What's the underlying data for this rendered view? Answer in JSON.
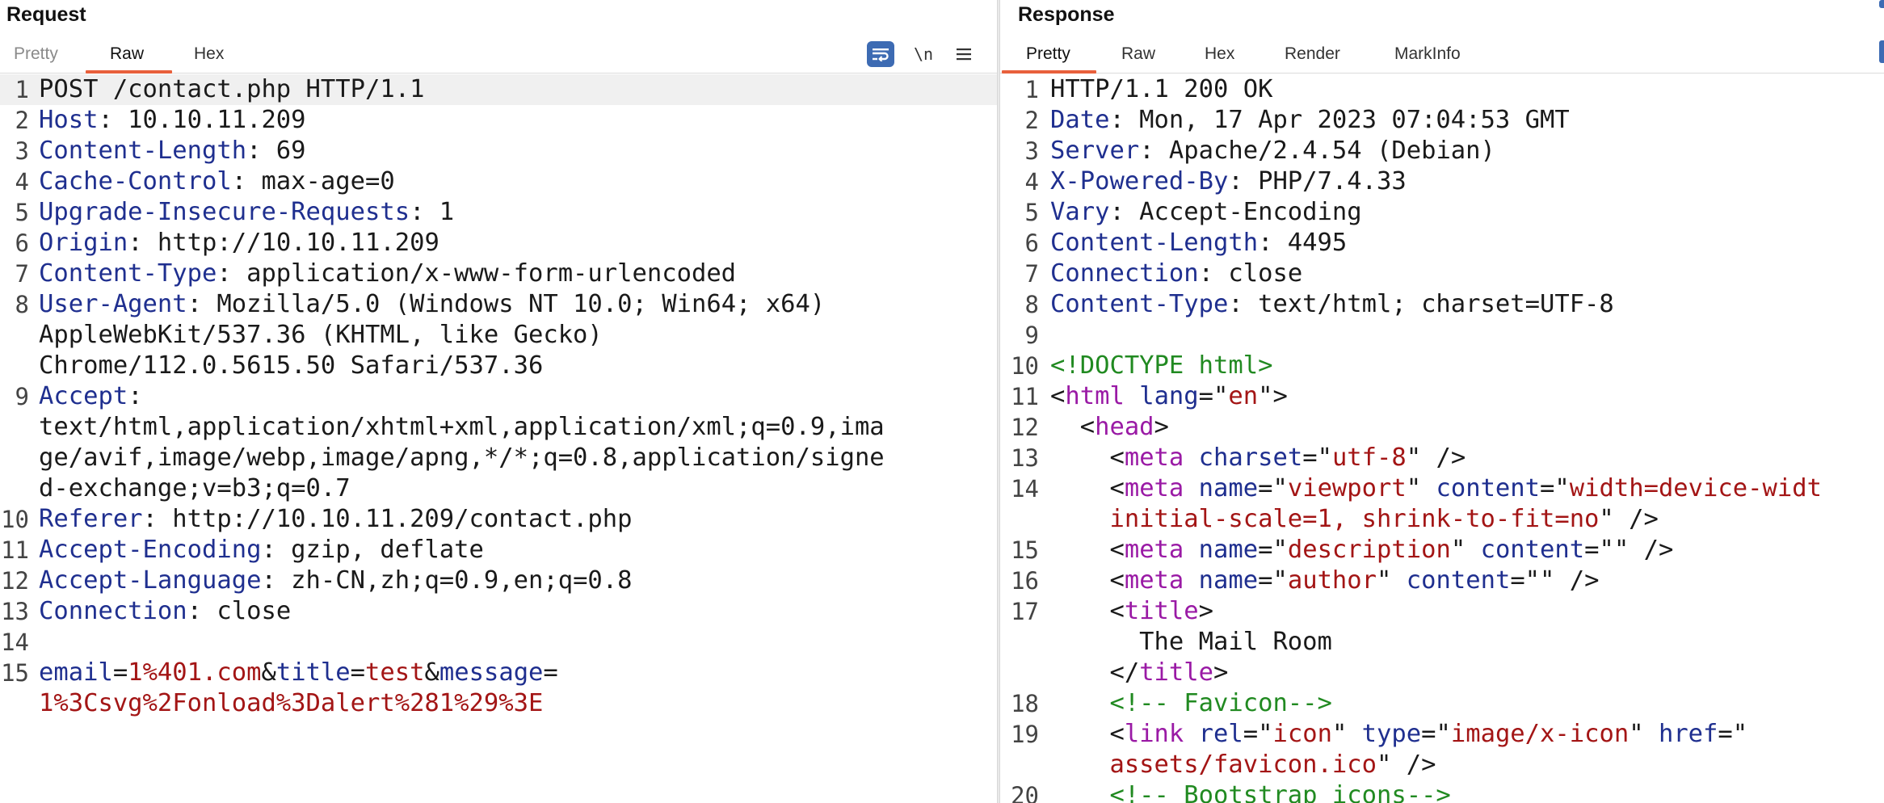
{
  "request": {
    "title": "Request",
    "tabs": [
      {
        "label": "Pretty",
        "state": "muted"
      },
      {
        "label": "Raw",
        "state": "active"
      },
      {
        "label": "Hex",
        "state": "normal"
      }
    ],
    "toolbar": {
      "wrap_icon": "wrap-lines-icon",
      "newline_label": "\\n",
      "menu_icon": "hamburger-menu-icon"
    },
    "lines": [
      {
        "n": "1",
        "parts": [
          [
            "POST /contact.php HTTP/1.1",
            "hv"
          ]
        ]
      },
      {
        "n": "2",
        "parts": [
          [
            "Host",
            "hn"
          ],
          [
            ": 10.10.11.209",
            "hv"
          ]
        ]
      },
      {
        "n": "3",
        "parts": [
          [
            "Content-Length",
            "hn"
          ],
          [
            ": 69",
            "hv"
          ]
        ]
      },
      {
        "n": "4",
        "parts": [
          [
            "Cache-Control",
            "hn"
          ],
          [
            ": max-age=0",
            "hv"
          ]
        ]
      },
      {
        "n": "5",
        "parts": [
          [
            "Upgrade-Insecure-Requests",
            "hn"
          ],
          [
            ": 1",
            "hv"
          ]
        ]
      },
      {
        "n": "6",
        "parts": [
          [
            "Origin",
            "hn"
          ],
          [
            ": http://10.10.11.209",
            "hv"
          ]
        ]
      },
      {
        "n": "7",
        "parts": [
          [
            "Content-Type",
            "hn"
          ],
          [
            ": application/x-www-form-urlencoded",
            "hv"
          ]
        ]
      },
      {
        "n": "8",
        "parts": [
          [
            "User-Agent",
            "hn"
          ],
          [
            ": Mozilla/5.0 (Windows NT 10.0; Win64; x64)",
            "hv"
          ]
        ]
      },
      {
        "n": "",
        "parts": [
          [
            "AppleWebKit/537.36 (KHTML, like Gecko)",
            "hv"
          ]
        ]
      },
      {
        "n": "",
        "parts": [
          [
            "Chrome/112.0.5615.50 Safari/537.36",
            "hv"
          ]
        ]
      },
      {
        "n": "9",
        "parts": [
          [
            "Accept",
            "hn"
          ],
          [
            ":",
            "hv"
          ]
        ]
      },
      {
        "n": "",
        "parts": [
          [
            "text/html,application/xhtml+xml,application/xml;q=0.9,ima",
            "hv"
          ]
        ]
      },
      {
        "n": "",
        "parts": [
          [
            "ge/avif,image/webp,image/apng,*/*;q=0.8,application/signe",
            "hv"
          ]
        ]
      },
      {
        "n": "",
        "parts": [
          [
            "d-exchange;v=b3;q=0.7",
            "hv"
          ]
        ]
      },
      {
        "n": "10",
        "parts": [
          [
            "Referer",
            "hn"
          ],
          [
            ": http://10.10.11.209/contact.php",
            "hv"
          ]
        ]
      },
      {
        "n": "11",
        "parts": [
          [
            "Accept-Encoding",
            "hn"
          ],
          [
            ": gzip, deflate",
            "hv"
          ]
        ]
      },
      {
        "n": "12",
        "parts": [
          [
            "Accept-Language",
            "hn"
          ],
          [
            ": zh-CN,zh;q=0.9,en;q=0.8",
            "hv"
          ]
        ]
      },
      {
        "n": "13",
        "parts": [
          [
            "Connection",
            "hn"
          ],
          [
            ": close",
            "hv"
          ]
        ]
      },
      {
        "n": "14",
        "parts": []
      },
      {
        "n": "15",
        "parts": [
          [
            "email",
            "pk"
          ],
          [
            "=",
            "hv"
          ],
          [
            "1%401.com",
            "pv"
          ],
          [
            "&",
            "hv"
          ],
          [
            "title",
            "pk"
          ],
          [
            "=",
            "hv"
          ],
          [
            "test",
            "pv"
          ],
          [
            "&",
            "hv"
          ],
          [
            "message",
            "pk"
          ],
          [
            "=",
            "hv"
          ]
        ]
      },
      {
        "n": "",
        "parts": [
          [
            "1%3Csvg%2Fonload%3Dalert%281%29%3E",
            "pv"
          ]
        ]
      }
    ]
  },
  "response": {
    "title": "Response",
    "tabs": [
      {
        "label": "Pretty",
        "state": "active"
      },
      {
        "label": "Raw",
        "state": "normal"
      },
      {
        "label": "Hex",
        "state": "normal"
      },
      {
        "label": "Render",
        "state": "normal"
      },
      {
        "label": "MarkInfo",
        "state": "normal"
      }
    ],
    "lines": [
      {
        "n": "1",
        "parts": [
          [
            "HTTP/1.1 200 OK",
            "hv"
          ]
        ]
      },
      {
        "n": "2",
        "parts": [
          [
            "Date",
            "hn"
          ],
          [
            ": Mon, 17 Apr 2023 07:04:53 GMT",
            "hv"
          ]
        ]
      },
      {
        "n": "3",
        "parts": [
          [
            "Server",
            "hn"
          ],
          [
            ": Apache/2.4.54 (Debian)",
            "hv"
          ]
        ]
      },
      {
        "n": "4",
        "parts": [
          [
            "X-Powered-By",
            "hn"
          ],
          [
            ": PHP/7.4.33",
            "hv"
          ]
        ]
      },
      {
        "n": "5",
        "parts": [
          [
            "Vary",
            "hn"
          ],
          [
            ": Accept-Encoding",
            "hv"
          ]
        ]
      },
      {
        "n": "6",
        "parts": [
          [
            "Content-Length",
            "hn"
          ],
          [
            ": 4495",
            "hv"
          ]
        ]
      },
      {
        "n": "7",
        "parts": [
          [
            "Connection",
            "hn"
          ],
          [
            ": close",
            "hv"
          ]
        ]
      },
      {
        "n": "8",
        "parts": [
          [
            "Content-Type",
            "hn"
          ],
          [
            ": text/html; charset=UTF-8",
            "hv"
          ]
        ]
      },
      {
        "n": "9",
        "parts": []
      },
      {
        "n": "10",
        "parts": [
          [
            "<!DOCTYPE html>",
            "cmt"
          ]
        ]
      },
      {
        "n": "11",
        "parts": [
          [
            "<",
            "punct"
          ],
          [
            "html",
            "tag"
          ],
          [
            " ",
            "punct"
          ],
          [
            "lang",
            "attr"
          ],
          [
            "=\"",
            "punct"
          ],
          [
            "en",
            "str"
          ],
          [
            "\">",
            "punct"
          ]
        ]
      },
      {
        "n": "12",
        "parts": [
          [
            "  <",
            "punct"
          ],
          [
            "head",
            "tag"
          ],
          [
            ">",
            "punct"
          ]
        ]
      },
      {
        "n": "13",
        "parts": [
          [
            "    <",
            "punct"
          ],
          [
            "meta",
            "tag"
          ],
          [
            " ",
            "punct"
          ],
          [
            "charset",
            "attr"
          ],
          [
            "=\"",
            "punct"
          ],
          [
            "utf-8",
            "str"
          ],
          [
            "\" />",
            "punct"
          ]
        ]
      },
      {
        "n": "14",
        "parts": [
          [
            "    <",
            "punct"
          ],
          [
            "meta",
            "tag"
          ],
          [
            " ",
            "punct"
          ],
          [
            "name",
            "attr"
          ],
          [
            "=\"",
            "punct"
          ],
          [
            "viewport",
            "str"
          ],
          [
            "\" ",
            "punct"
          ],
          [
            "content",
            "attr"
          ],
          [
            "=\"",
            "punct"
          ],
          [
            "width=device-widt",
            "str"
          ]
        ]
      },
      {
        "n": "",
        "parts": [
          [
            "    ",
            "punct"
          ],
          [
            "initial-scale=1, shrink-to-fit=no",
            "str"
          ],
          [
            "\" />",
            "punct"
          ]
        ]
      },
      {
        "n": "15",
        "parts": [
          [
            "    <",
            "punct"
          ],
          [
            "meta",
            "tag"
          ],
          [
            " ",
            "punct"
          ],
          [
            "name",
            "attr"
          ],
          [
            "=\"",
            "punct"
          ],
          [
            "description",
            "str"
          ],
          [
            "\" ",
            "punct"
          ],
          [
            "content",
            "attr"
          ],
          [
            "=\"\" />",
            "punct"
          ]
        ]
      },
      {
        "n": "16",
        "parts": [
          [
            "    <",
            "punct"
          ],
          [
            "meta",
            "tag"
          ],
          [
            " ",
            "punct"
          ],
          [
            "name",
            "attr"
          ],
          [
            "=\"",
            "punct"
          ],
          [
            "author",
            "str"
          ],
          [
            "\" ",
            "punct"
          ],
          [
            "content",
            "attr"
          ],
          [
            "=\"\" />",
            "punct"
          ]
        ]
      },
      {
        "n": "17",
        "parts": [
          [
            "    <",
            "punct"
          ],
          [
            "title",
            "tag"
          ],
          [
            ">",
            "punct"
          ]
        ]
      },
      {
        "n": "",
        "parts": [
          [
            "      The Mail Room",
            "hv"
          ]
        ]
      },
      {
        "n": "",
        "parts": [
          [
            "    </",
            "punct"
          ],
          [
            "title",
            "tag"
          ],
          [
            ">",
            "punct"
          ]
        ]
      },
      {
        "n": "18",
        "parts": [
          [
            "    <!-- Favicon-->",
            "cmt"
          ]
        ]
      },
      {
        "n": "19",
        "parts": [
          [
            "    <",
            "punct"
          ],
          [
            "link",
            "tag"
          ],
          [
            " ",
            "punct"
          ],
          [
            "rel",
            "attr"
          ],
          [
            "=\"",
            "punct"
          ],
          [
            "icon",
            "str"
          ],
          [
            "\" ",
            "punct"
          ],
          [
            "type",
            "attr"
          ],
          [
            "=\"",
            "punct"
          ],
          [
            "image/x-icon",
            "str"
          ],
          [
            "\" ",
            "punct"
          ],
          [
            "href",
            "attr"
          ],
          [
            "=\"",
            "punct"
          ]
        ]
      },
      {
        "n": "",
        "parts": [
          [
            "    ",
            "punct"
          ],
          [
            "assets/favicon.ico",
            "str"
          ],
          [
            "\" />",
            "punct"
          ]
        ]
      },
      {
        "n": "20",
        "parts": [
          [
            "    <!-- Bootstrap icons-->",
            "cmt"
          ]
        ]
      }
    ]
  },
  "colors": {
    "accent_tab": "#e8603c",
    "header_name": "#1f2f8f",
    "param_value": "#a31515",
    "tag": "#9a1aa5",
    "comment": "#218a21",
    "toolbar_button": "#3d6bb3"
  }
}
